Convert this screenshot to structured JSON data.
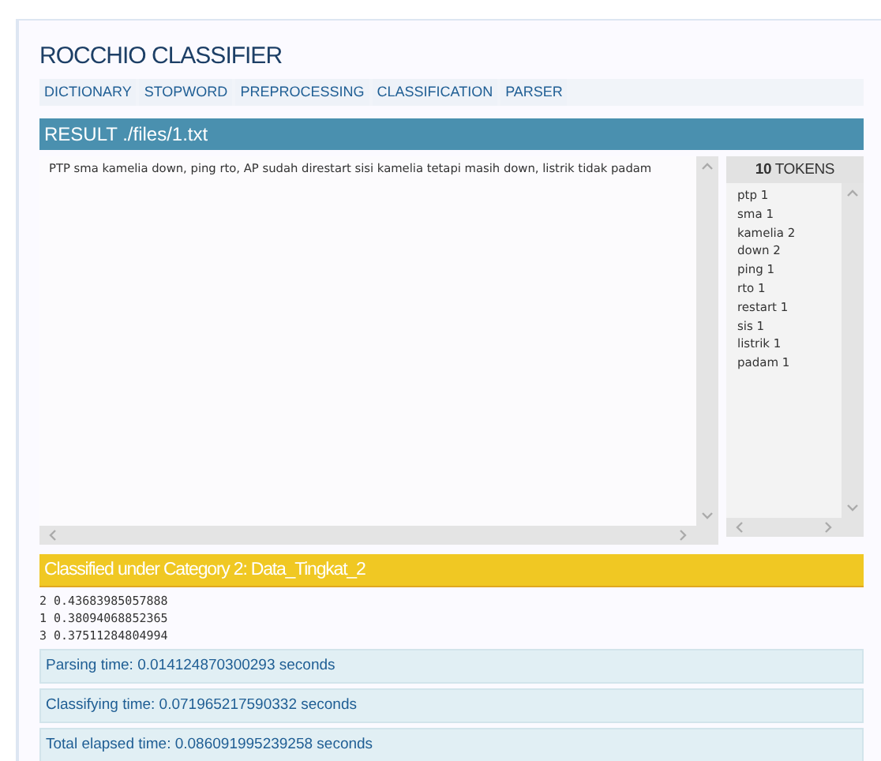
{
  "app": {
    "title": "ROCCHIO CLASSIFIER"
  },
  "nav": [
    {
      "label": "DICTIONARY"
    },
    {
      "label": "STOPWORD"
    },
    {
      "label": "PREPROCESSING"
    },
    {
      "label": "CLASSIFICATION"
    },
    {
      "label": "PARSER"
    }
  ],
  "result": {
    "heading": "RESULT ./files/1.txt",
    "text": "PTP sma kamelia down, ping rto, AP sudah direstart sisi kamelia tetapi masih down, listrik tidak padam",
    "tokens_heading": "**10** TOKENS",
    "tokens": [
      "ptp 1",
      "sma 1",
      "kamelia 2",
      "down 2",
      "ping 1",
      "rto 1",
      "restart 1",
      "sis 1",
      "listrik 1",
      "padam 1"
    ]
  },
  "classification": {
    "heading": "Classified under Category 2: Data_Tingkat_2",
    "scores": [
      "2 0.43683985057888",
      "1 0.38094068852365",
      "3 0.37511284804994"
    ]
  },
  "timings": [
    "Parsing time: 0.014124870300293 seconds",
    "Classifying time: 0.071965217590332 seconds",
    "Total elapsed time: 0.086091995239258 seconds"
  ]
}
